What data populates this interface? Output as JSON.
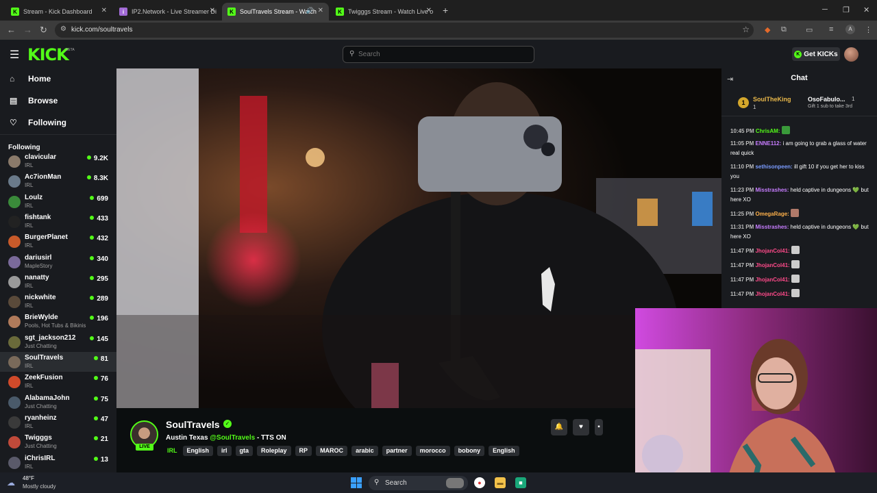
{
  "browser": {
    "tabs": [
      {
        "title": "Stream - Kick Dashboard",
        "icon": "kick-icon",
        "active": false
      },
      {
        "title": "IP2.Network - Live Streamer Di",
        "icon": "ip2-icon",
        "active": false
      },
      {
        "title": "SoulTravels Stream - Watch",
        "icon": "kick-icon",
        "active": true
      },
      {
        "title": "Twigggs Stream - Watch Live o",
        "icon": "kick-icon",
        "active": false
      }
    ],
    "url": "kick.com/soultravels"
  },
  "header": {
    "logo": "KICK",
    "beta": "BETA",
    "search_placeholder": "Search",
    "get_kicks_label": "Get KICKs"
  },
  "sidebar": {
    "nav": [
      {
        "label": "Home",
        "icon": "home-icon"
      },
      {
        "label": "Browse",
        "icon": "browse-icon"
      },
      {
        "label": "Following",
        "icon": "heart-icon"
      }
    ],
    "following_title": "Following",
    "channels": [
      {
        "name": "clavicular",
        "category": "IRL",
        "viewers": "9.2K",
        "color": "#8a7a6a"
      },
      {
        "name": "Ac7ionMan",
        "category": "IRL",
        "viewers": "8.3K",
        "color": "#6a7a8a"
      },
      {
        "name": "Loulz",
        "category": "IRL",
        "viewers": "699",
        "color": "#3a8a3a"
      },
      {
        "name": "fishtank",
        "category": "IRL",
        "viewers": "433",
        "color": "#222222"
      },
      {
        "name": "BurgerPlanet",
        "category": "IRL",
        "viewers": "432",
        "color": "#c85a2a"
      },
      {
        "name": "dariusirl",
        "category": "MapleStory",
        "viewers": "340",
        "color": "#7a6a9a"
      },
      {
        "name": "nanatty",
        "category": "IRL",
        "viewers": "295",
        "color": "#9a9a9a"
      },
      {
        "name": "nickwhite",
        "category": "IRL",
        "viewers": "289",
        "color": "#5a4a3a"
      },
      {
        "name": "BrieWylde",
        "category": "Pools, Hot Tubs & Bikinis",
        "viewers": "196",
        "color": "#b07a5a"
      },
      {
        "name": "sgt_jackson212",
        "category": "Just Chatting",
        "viewers": "145",
        "color": "#6a6a3a"
      },
      {
        "name": "SoulTravels",
        "category": "IRL",
        "viewers": "81",
        "color": "#7a6a5a"
      },
      {
        "name": "ZeekFusion",
        "category": "IRL",
        "viewers": "76",
        "color": "#d04a2a"
      },
      {
        "name": "AlabamaJohn",
        "category": "Just Chatting",
        "viewers": "75",
        "color": "#4a5a6a"
      },
      {
        "name": "ryanheinz",
        "category": "IRL",
        "viewers": "47",
        "color": "#3a3a3a"
      },
      {
        "name": "Twigggs",
        "category": "Just Chatting",
        "viewers": "21",
        "color": "#c04a3a"
      },
      {
        "name": "iChrisIRL",
        "category": "IRL",
        "viewers": "13",
        "color": "#5a5a6a"
      }
    ]
  },
  "stream": {
    "streamer": "SoulTravels",
    "live_label": "LIVE",
    "title_prefix": "Austin Texas",
    "title_mention": "@SoulTravels",
    "title_suffix": "- TTS ON",
    "category": "IRL",
    "tags": [
      "English",
      "irl",
      "gta",
      "Roleplay",
      "RP",
      "MAROC",
      "arabic",
      "partner",
      "morocco",
      "bobony",
      "English"
    ]
  },
  "chat": {
    "title": "Chat",
    "top_gifter": {
      "rank": "1",
      "user1": "SoulTheKing",
      "count1": "1",
      "user2": "OsoFabulo...",
      "count2": "1",
      "note": "Gift 1 sub to take 3rd"
    },
    "messages": [
      {
        "time": "10:45 PM",
        "user": "ChrisAM:",
        "text": "",
        "color": "#53fc18",
        "emote": "#3a9a3a"
      },
      {
        "time": "11:05 PM",
        "user": "ENNE112:",
        "text": "i am going to grab a glass of water real quick",
        "color": "#c77dff",
        "emote": ""
      },
      {
        "time": "11:10 PM",
        "user": "sethisonpeen:",
        "text": "ill gift 10 if you get her to kiss you",
        "color": "#7b9cff",
        "emote": ""
      },
      {
        "time": "11:23 PM",
        "user": "Misstrashes:",
        "text": "held captive in dungeons 💚 but here XO",
        "color": "#c77dff",
        "emote": ""
      },
      {
        "time": "11:25 PM",
        "user": "OmegaRage:",
        "text": "",
        "color": "#ffb14a",
        "emote": "#b07a6a"
      },
      {
        "time": "11:31 PM",
        "user": "Misstrashes:",
        "text": "held captive in dungeons 💚 but here XO",
        "color": "#c77dff",
        "emote": ""
      },
      {
        "time": "11:47 PM",
        "user": "JhojanCol41:",
        "text": "",
        "color": "#ff4a8a",
        "emote": "#cccccc"
      },
      {
        "time": "11:47 PM",
        "user": "JhojanCol41:",
        "text": "",
        "color": "#ff4a8a",
        "emote": "#cccccc"
      },
      {
        "time": "11:47 PM",
        "user": "JhojanCol41:",
        "text": "",
        "color": "#ff4a8a",
        "emote": "#cccccc"
      },
      {
        "time": "11:47 PM",
        "user": "JhojanCol41:",
        "text": "",
        "color": "#ff4a8a",
        "emote": "#cccccc"
      }
    ]
  },
  "taskbar": {
    "temp": "48°F",
    "weather": "Mostly cloudy",
    "search_label": "Search"
  },
  "colors": {
    "accent": "#53fc18",
    "bg": "#0b0e0f",
    "panel": "#191b1f"
  }
}
